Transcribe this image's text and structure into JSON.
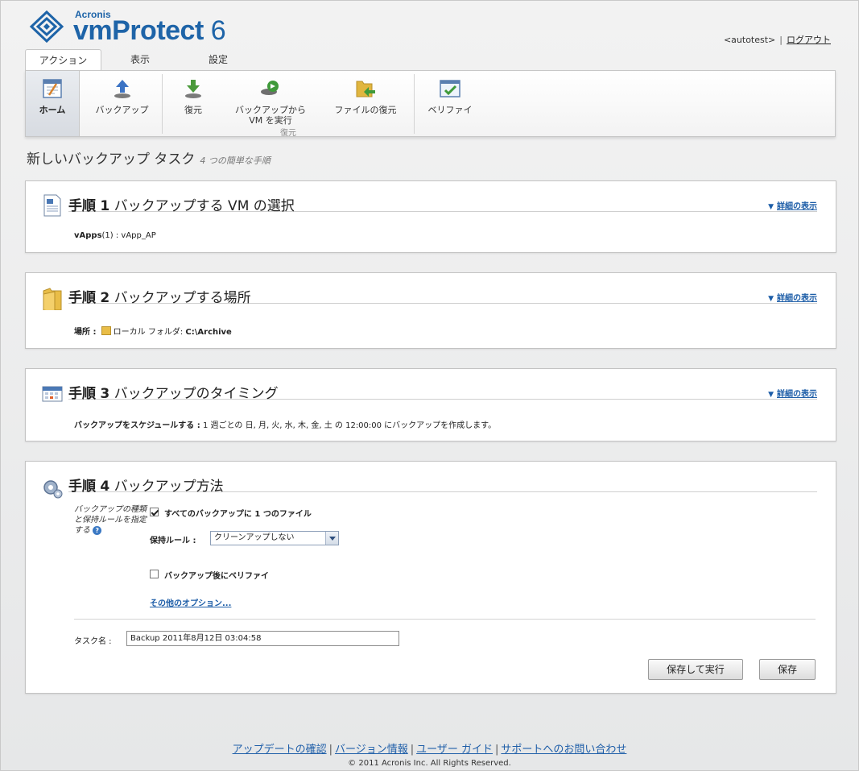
{
  "header": {
    "brand_small": "Acronis",
    "brand_main": "vmProtect",
    "brand_version": "6",
    "user": "<autotest>",
    "logout": "ログアウト"
  },
  "tabs": [
    {
      "label": "アクション",
      "active": true
    },
    {
      "label": "表示",
      "active": false
    },
    {
      "label": "設定",
      "active": false
    }
  ],
  "ribbon": {
    "home": "ホーム",
    "backup": "バックアップ",
    "restore": "復元",
    "run_vm_line1": "バックアップから",
    "run_vm_line2": "VM を実行",
    "file_restore": "ファイルの復元",
    "verify": "ベリファイ",
    "restore_group": "復元"
  },
  "page": {
    "title": "新しいバックアップ タスク",
    "subtitle": "4 つの簡単な手順"
  },
  "steps": [
    {
      "step_word": "手順",
      "num": "1",
      "title": "バックアップする VM の選択",
      "detail": "詳細の表示",
      "line_label": "vApps",
      "line_value": "(1) : vApp_AP"
    },
    {
      "step_word": "手順",
      "num": "2",
      "title": "バックアップする場所",
      "detail": "詳細の表示",
      "line_label": "場所 :",
      "line_value": "ローカル フォルダ: ",
      "line_value_bold": "C:\\Archive"
    },
    {
      "step_word": "手順",
      "num": "3",
      "title": "バックアップのタイミング",
      "detail": "詳細の表示",
      "line_label": "バックアップをスケジュールする :",
      "line_value": "1 週ごとの 日, 月, 火, 水, 木, 金, 土 の 12:00:00 にバックアップを作成します。"
    },
    {
      "step_word": "手順",
      "num": "4",
      "title": "バックアップ方法",
      "side_note": "バックアップの種類と保持ルールを指定する",
      "help": "?",
      "single_file_label": "すべてのバックアップに 1 つのファイル",
      "single_file_checked": true,
      "retention_label": "保持ルール :",
      "retention_value": "クリーンアップしない",
      "verify_label": "バックアップ後にベリファイ",
      "verify_checked": false,
      "more_options": "その他のオプション...",
      "task_name_label": "タスク名 :",
      "task_name_value": "Backup 2011年8月12日 03:04:58",
      "save_run": "保存して実行",
      "save": "保存"
    }
  ],
  "footer": {
    "links": [
      "アップデートの確認",
      "バージョン情報",
      "ユーザー ガイド",
      "サポートへのお問い合わせ"
    ],
    "copyright": "© 2011 Acronis Inc. All Rights Reserved."
  },
  "colors": {
    "brand_blue": "#1e64a8",
    "link_blue": "#1e5ea8"
  }
}
